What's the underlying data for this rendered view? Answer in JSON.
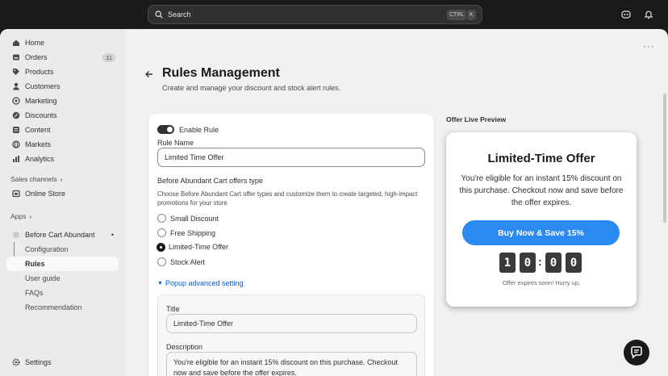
{
  "topbar": {
    "search_placeholder": "Search",
    "shortcut_key1": "CTRL",
    "shortcut_key2": "K"
  },
  "sidebar": {
    "items": [
      {
        "label": "Home",
        "icon": "home-icon"
      },
      {
        "label": "Orders",
        "icon": "orders-icon",
        "badge": "11"
      },
      {
        "label": "Products",
        "icon": "tag-icon"
      },
      {
        "label": "Customers",
        "icon": "person-icon"
      },
      {
        "label": "Marketing",
        "icon": "target-icon"
      },
      {
        "label": "Discounts",
        "icon": "discount-icon"
      },
      {
        "label": "Content",
        "icon": "content-icon"
      },
      {
        "label": "Markets",
        "icon": "globe-icon"
      },
      {
        "label": "Analytics",
        "icon": "chart-icon"
      }
    ],
    "sales_channels_label": "Sales channels",
    "online_store_label": "Online Store",
    "apps_label": "Apps",
    "app_name": "Before Cart Abundant",
    "app_subitems": [
      "Configuration",
      "Rules",
      "User guide",
      "FAQs",
      "Recommendation"
    ],
    "settings_label": "Settings"
  },
  "page": {
    "title": "Rules Management",
    "subtitle": "Create and manage your discount and stock alert rules."
  },
  "form": {
    "enable_label": "Enable Rule",
    "rule_name_label": "Rule Name",
    "rule_name_value": "Limited Time Offer",
    "offer_type_label": "Before Abundant Cart offers type",
    "offer_type_help": "Choose Before Abundant Cart offer types and customize them to create targeted, high-impact promotions for your store",
    "options": [
      "Small Discount",
      "Free Shipping",
      "Limited-Time Offer",
      "Stock Alert"
    ],
    "selected_option": "Limited-Time Offer",
    "advanced_link": "Popup advanced setting",
    "title_label": "Title",
    "title_value": "Limited-Time Offer",
    "description_label": "Description",
    "description_value": "You're eligible for an instant 15% discount on this purchase. Checkout now and save before the offer expires."
  },
  "preview": {
    "label": "Offer Live Preview",
    "title": "Limited-Time Offer",
    "description": "You're eligible for an instant 15% discount on this purchase. Checkout now and save before the offer expires.",
    "button": "Buy Now & Save 15%",
    "digits": [
      "1",
      "0",
      "0",
      "0"
    ],
    "separator": ":",
    "note": "Offer expires soon! Hurry up.",
    "button_color": "#2b8af2"
  }
}
